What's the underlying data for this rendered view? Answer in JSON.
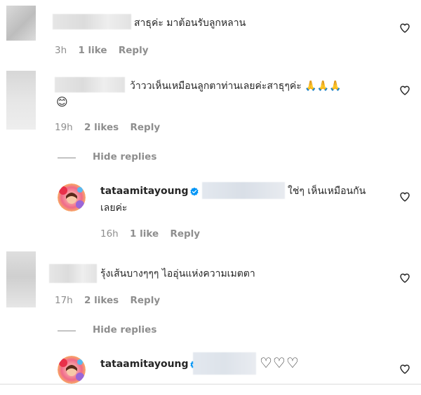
{
  "comments": [
    {
      "text": "สาธุค่ะ มาต้อนรับลูกหลาน",
      "meta": {
        "time": "3h",
        "likes": "1 like",
        "reply": "Reply"
      }
    },
    {
      "text": "ว้าววเห็นเหมือนลูกตาท่านเลยค่ะสาธุๆค่ะ",
      "emoji_pray": "🙏🙏🙏",
      "emoji_smile": "😊",
      "meta": {
        "time": "19h",
        "likes": "2 likes",
        "reply": "Reply"
      },
      "hide_replies": "Hide replies",
      "reply": {
        "username": "tataamitayoung",
        "text_line1": "ใช่ๆ เห็นเหมือนกัน",
        "text_line2": "เลยค่ะ",
        "meta": {
          "time": "16h",
          "likes": "1 like",
          "reply": "Reply"
        }
      }
    },
    {
      "text": "รุ้งเส้นบางๆๆๆ ไออุ่นแห่งความเมตตา",
      "meta": {
        "time": "17h",
        "likes": "2 likes",
        "reply": "Reply"
      },
      "hide_replies": "Hide replies",
      "reply": {
        "username": "tataamitayoung",
        "text": "♡♡♡"
      }
    }
  ],
  "icons": {
    "heart": "heart-outline-icon",
    "verified": "verified-badge-icon"
  },
  "colors": {
    "text": "#262626",
    "secondary": "#8e8e8e",
    "verified": "#0095f6",
    "divider": "#dbdbdb"
  }
}
